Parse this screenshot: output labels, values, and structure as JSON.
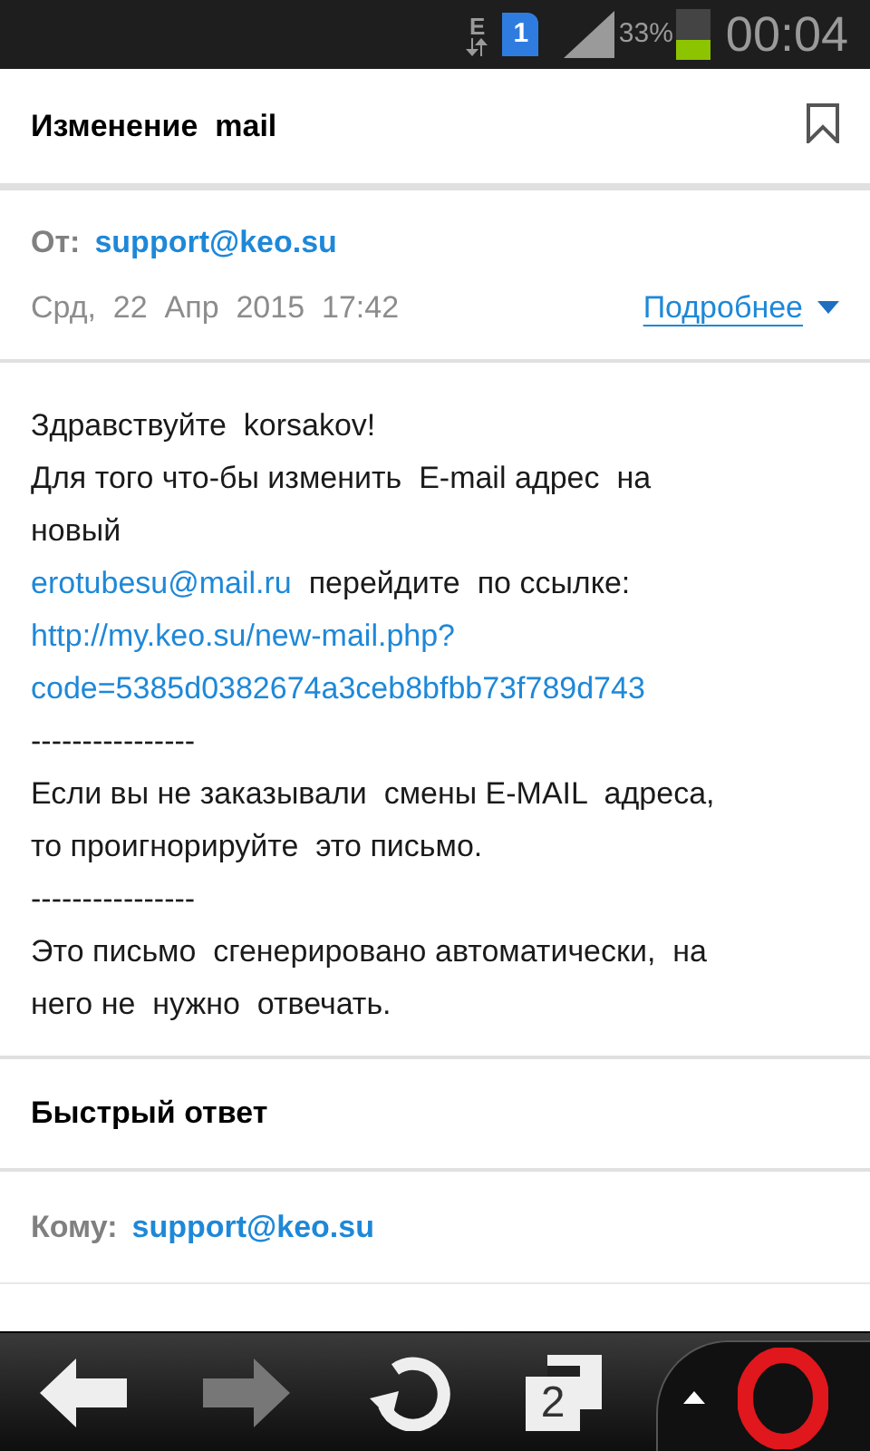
{
  "status_bar": {
    "network": "E",
    "sim": "1",
    "battery_text": "33%",
    "time": "00:04"
  },
  "message": {
    "subject": "Изменение  mail",
    "bookmarked": false,
    "from_label": "От:",
    "from": "support@keo.su",
    "date": "Срд,  22  Апр  2015  17:42",
    "details_link": "Подробнее",
    "body": [
      [
        {
          "text": "Здравствуйте  korsakov!",
          "link": false
        }
      ],
      [
        {
          "text": "Для того что-бы изменить  E-mail адрес  на",
          "link": false
        }
      ],
      [
        {
          "text": "новый",
          "link": false
        }
      ],
      [
        {
          "text": "erotubesu@mail.ru",
          "link": true
        },
        {
          "text": "  перейдите  по ссылке:",
          "link": false
        }
      ],
      [
        {
          "text": "http://my.keo.su/new-mail.php?",
          "link": true
        }
      ],
      [
        {
          "text": "code=5385d0382674a3ceb8bfbb73f789d743",
          "link": true
        }
      ],
      [
        {
          "text": "----------------",
          "link": false
        }
      ],
      [
        {
          "text": "Если вы не заказывали  смены E-MAIL  адреса,",
          "link": false
        }
      ],
      [
        {
          "text": "то проигнорируйте  это письмо.",
          "link": false
        }
      ],
      [
        {
          "text": "----------------",
          "link": false
        }
      ],
      [
        {
          "text": "Это письмо  сгенерировано автоматически,  на",
          "link": false
        }
      ],
      [
        {
          "text": "него не  нужно  отвечать.",
          "link": false
        }
      ]
    ]
  },
  "quick_reply": {
    "title": "Быстрый ответ",
    "to_label": "Кому:",
    "to": "support@keo.su"
  },
  "browser_bar": {
    "back_disabled": false,
    "forward_disabled": true,
    "tab_count": "2"
  }
}
